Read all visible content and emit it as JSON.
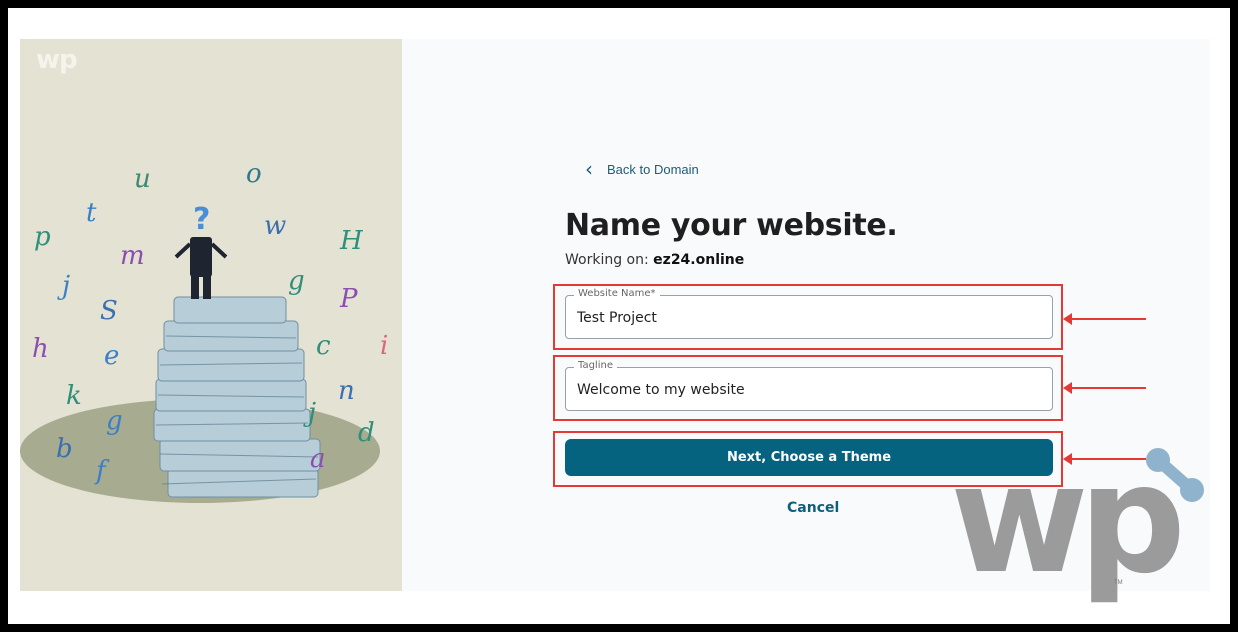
{
  "art": {
    "logo": "wp",
    "letters": [
      "u",
      "o",
      "t",
      "p",
      "m",
      "w",
      "H",
      "j",
      "g",
      "P",
      "S",
      "c",
      "i",
      "h",
      "e",
      "k",
      "g",
      "n",
      "b",
      "j",
      "a",
      "d",
      "f"
    ],
    "accent_colors": [
      "#2f8f7a",
      "#3a7fc8",
      "#8a4fb0",
      "#e0647a"
    ]
  },
  "form": {
    "back_label": "Back to Domain",
    "title": "Name your website.",
    "working_prefix": "Working on:",
    "domain": "ez24.online",
    "website_name": {
      "legend": "Website Name*",
      "value": "Test Project"
    },
    "tagline": {
      "legend": "Tagline",
      "value": "Welcome to my website"
    },
    "next_button": "Next, Choose a Theme",
    "cancel": "Cancel"
  },
  "watermark": {
    "logo": "wp",
    "tm": "TM"
  },
  "colors": {
    "primary": "#056380",
    "link": "#1c5d78",
    "annotation": "#e53935",
    "panel_bg": "#f9fafc"
  }
}
